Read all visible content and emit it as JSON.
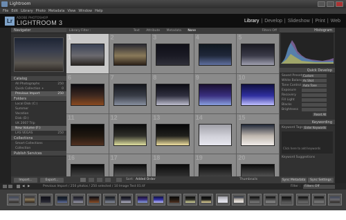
{
  "window": {
    "title": "Lightroom"
  },
  "menu": [
    "File",
    "Edit",
    "Library",
    "Photo",
    "Metadata",
    "View",
    "Window",
    "Help"
  ],
  "identity": {
    "logo": "Lr",
    "adobe": "ADOBE PHOTOSHOP",
    "product": "LIGHTROOM 3"
  },
  "modules": [
    {
      "label": "Library",
      "active": true
    },
    {
      "label": "|",
      "active": false
    },
    {
      "label": "Develop",
      "active": false
    },
    {
      "label": "|",
      "active": false
    },
    {
      "label": "Slideshow",
      "active": false
    },
    {
      "label": "|",
      "active": false
    },
    {
      "label": "Print",
      "active": false
    },
    {
      "label": "|",
      "active": false
    },
    {
      "label": "Web",
      "active": false
    }
  ],
  "left": {
    "navigator": "Navigator",
    "navigator_zoom": "FIT FILL 1:1 3:1",
    "catalog": "Catalog",
    "catalog_items": [
      {
        "label": "All Photographs",
        "count": "250",
        "selected": false
      },
      {
        "label": "Quick Collection +",
        "count": "0",
        "selected": false
      },
      {
        "label": "Previous Import",
        "count": "250",
        "selected": true
      }
    ],
    "folders": "Folders",
    "folder_items": [
      {
        "label": "Local Disk (C:)",
        "count": "",
        "selected": false
      },
      {
        "label": "Summer",
        "count": "",
        "selected": false
      },
      {
        "label": "Vacation",
        "count": "",
        "selected": false
      },
      {
        "label": "Disk (D:)",
        "count": "",
        "selected": false
      },
      {
        "label": "UK 2007 Trip",
        "count": "",
        "selected": false
      },
      {
        "label": "New Volume (F:)",
        "count": "",
        "selected": true
      },
      {
        "label": "LAS VEGAS",
        "count": "250",
        "selected": false
      }
    ],
    "collections": "Collections",
    "collection_items": [
      {
        "label": "Smart Collections",
        "count": "",
        "selected": false
      },
      {
        "label": "Collection",
        "count": "",
        "selected": false
      }
    ],
    "publish": "Publish Services",
    "import_btn": "Import...",
    "export_btn": "Export..."
  },
  "filterbar": {
    "label": "Library Filter :",
    "text": "Text",
    "attribute": "Attribute",
    "metadata": "Metadata",
    "none": "None",
    "preset": "Filters Off"
  },
  "grid": {
    "rows": [
      [
        1,
        2,
        3,
        4,
        5
      ],
      [
        6,
        7,
        8,
        9,
        10
      ],
      [
        11,
        12,
        13,
        14,
        15
      ],
      [
        16,
        17,
        18,
        19,
        20
      ]
    ]
  },
  "toolbar": {
    "sort_label": "Sort:",
    "sort_value": "Added Order",
    "thumbnails_label": "Thumbnails"
  },
  "right": {
    "histogram": "Histogram",
    "quick_develop": "Quick Develop",
    "rows": [
      {
        "label": "Saved Preset",
        "value": "Custom"
      },
      {
        "label": "White Balance",
        "value": "As Shot"
      },
      {
        "label": "Tone Control",
        "value": "Auto Tone"
      },
      {
        "label": "Exposure",
        "value": ""
      },
      {
        "label": "Recovery",
        "value": ""
      },
      {
        "label": "Fill Light",
        "value": ""
      },
      {
        "label": "Blacks",
        "value": ""
      },
      {
        "label": "Brightness",
        "value": ""
      }
    ],
    "reset": "Reset All",
    "keywording": "Keywording",
    "keyword_tags": "Keyword Tags",
    "keyword_mode": "Enter Keywords",
    "keyword_hint": "Click here to add keywords",
    "keyword_suggestions": "Keyword Suggestions",
    "sync_meta": "Sync Metadata",
    "sync_settings": "Sync Settings"
  },
  "filmstrip_header": {
    "text": "Previous Import / 250 photos / 250 selected / 10 Image Test 01.tif",
    "filter_label": "Filter :",
    "filter_value": "Filters Off"
  }
}
